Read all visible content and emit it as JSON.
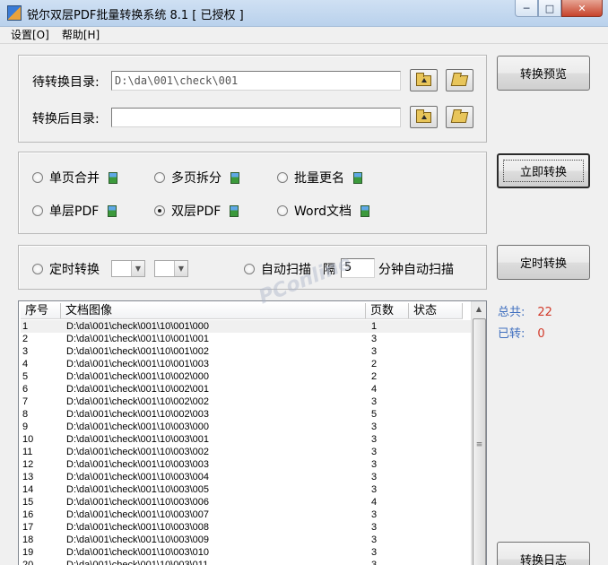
{
  "window": {
    "title": "锐尔双层PDF批量转换系统 8.1 [ 已授权 ]",
    "min_glyph": "─",
    "max_glyph": "□",
    "close_glyph": "✕"
  },
  "menu": {
    "items": [
      "设置[O]",
      "帮助[H]"
    ]
  },
  "dirs": {
    "source_label": "待转换目录:",
    "source_value": "D:\\da\\001\\check\\001",
    "target_label": "转换后目录:",
    "target_value": ""
  },
  "mode": {
    "options": [
      {
        "label": "单页合并",
        "selected": false
      },
      {
        "label": "多页拆分",
        "selected": false
      },
      {
        "label": "批量更名",
        "selected": false
      },
      {
        "label": "单层PDF",
        "selected": false
      },
      {
        "label": "双层PDF",
        "selected": true
      },
      {
        "label": "Word文档",
        "selected": false
      }
    ]
  },
  "schedule": {
    "timed_label": "定时转换",
    "auto_scan_label": "自动扫描",
    "interval_prefix": "隔",
    "interval_value": "5",
    "interval_suffix": "分钟自动扫描",
    "combo_arrow": "▼"
  },
  "actions": {
    "preview": "转换预览",
    "convert_now": "立即转换",
    "timed_convert": "定时转换",
    "log": "转换日志"
  },
  "stats": {
    "total_label": "总共:",
    "total_value": "22",
    "done_label": "已转:",
    "done_value": "0"
  },
  "table": {
    "columns": [
      "序号",
      "文档图像",
      "页数",
      "状态"
    ],
    "rows": [
      [
        "1",
        "D:\\da\\001\\check\\001\\10\\001\\000",
        "1",
        ""
      ],
      [
        "2",
        "D:\\da\\001\\check\\001\\10\\001\\001",
        "3",
        ""
      ],
      [
        "3",
        "D:\\da\\001\\check\\001\\10\\001\\002",
        "3",
        ""
      ],
      [
        "4",
        "D:\\da\\001\\check\\001\\10\\001\\003",
        "2",
        ""
      ],
      [
        "5",
        "D:\\da\\001\\check\\001\\10\\002\\000",
        "2",
        ""
      ],
      [
        "6",
        "D:\\da\\001\\check\\001\\10\\002\\001",
        "4",
        ""
      ],
      [
        "7",
        "D:\\da\\001\\check\\001\\10\\002\\002",
        "3",
        ""
      ],
      [
        "8",
        "D:\\da\\001\\check\\001\\10\\002\\003",
        "5",
        ""
      ],
      [
        "9",
        "D:\\da\\001\\check\\001\\10\\003\\000",
        "3",
        ""
      ],
      [
        "10",
        "D:\\da\\001\\check\\001\\10\\003\\001",
        "3",
        ""
      ],
      [
        "11",
        "D:\\da\\001\\check\\001\\10\\003\\002",
        "3",
        ""
      ],
      [
        "12",
        "D:\\da\\001\\check\\001\\10\\003\\003",
        "3",
        ""
      ],
      [
        "13",
        "D:\\da\\001\\check\\001\\10\\003\\004",
        "3",
        ""
      ],
      [
        "14",
        "D:\\da\\001\\check\\001\\10\\003\\005",
        "3",
        ""
      ],
      [
        "15",
        "D:\\da\\001\\check\\001\\10\\003\\006",
        "4",
        ""
      ],
      [
        "16",
        "D:\\da\\001\\check\\001\\10\\003\\007",
        "3",
        ""
      ],
      [
        "17",
        "D:\\da\\001\\check\\001\\10\\003\\008",
        "3",
        ""
      ],
      [
        "18",
        "D:\\da\\001\\check\\001\\10\\003\\009",
        "3",
        ""
      ],
      [
        "19",
        "D:\\da\\001\\check\\001\\10\\003\\010",
        "3",
        ""
      ],
      [
        "20",
        "D:\\da\\001\\check\\001\\10\\003\\011",
        "3",
        ""
      ]
    ],
    "scroll_up_glyph": "▲",
    "scroll_grip_glyph": "≡"
  },
  "watermark": "PConline"
}
